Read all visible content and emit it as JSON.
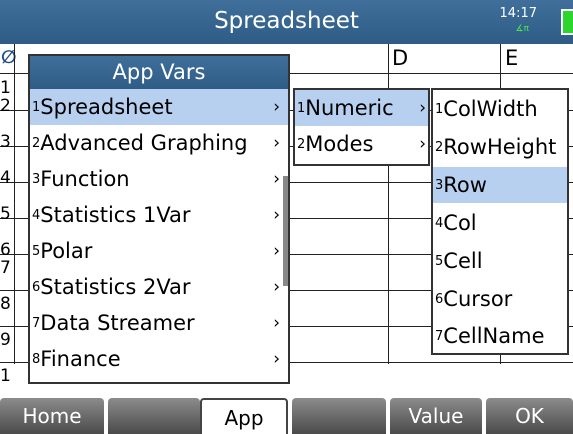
{
  "titlebar": {
    "title": "Spreadsheet",
    "time": "14:17",
    "angle_indicator": "∡π"
  },
  "grid": {
    "columns": [
      "D",
      "E"
    ],
    "rows": [
      "1",
      "2",
      "3",
      "4",
      "5",
      "6",
      "7",
      "8",
      "9",
      "1"
    ]
  },
  "app_vars_menu": {
    "header": "App Vars",
    "items": [
      {
        "num": "1",
        "label": "Spreadsheet",
        "arrow": "›"
      },
      {
        "num": "2",
        "label": "Advanced Graphing",
        "arrow": "›"
      },
      {
        "num": "3",
        "label": "Function",
        "arrow": "›"
      },
      {
        "num": "4",
        "label": "Statistics 1Var",
        "arrow": "›"
      },
      {
        "num": "5",
        "label": "Polar",
        "arrow": "›"
      },
      {
        "num": "6",
        "label": "Statistics 2Var",
        "arrow": "›"
      },
      {
        "num": "7",
        "label": "Data Streamer",
        "arrow": "›"
      },
      {
        "num": "8",
        "label": "Finance",
        "arrow": "›"
      }
    ]
  },
  "sub_menu": {
    "items": [
      {
        "num": "1",
        "label": "Numeric",
        "arrow": "›"
      },
      {
        "num": "2",
        "label": "Modes",
        "arrow": "›"
      }
    ]
  },
  "numeric_menu": {
    "items": [
      {
        "num": "1",
        "label": "ColWidth"
      },
      {
        "num": "2",
        "label": "RowHeight"
      },
      {
        "num": "3",
        "label": "Row"
      },
      {
        "num": "4",
        "label": "Col"
      },
      {
        "num": "5",
        "label": "Cell"
      },
      {
        "num": "6",
        "label": "Cursor"
      },
      {
        "num": "7",
        "label": "CellName"
      }
    ]
  },
  "softkeys": [
    "Home",
    "",
    "App",
    "",
    "Value",
    "OK"
  ]
}
